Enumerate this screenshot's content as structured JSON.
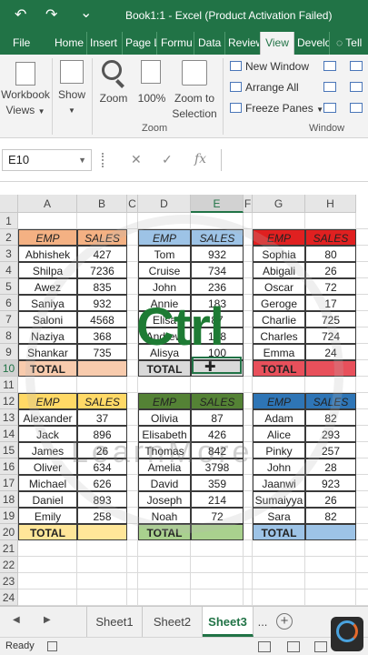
{
  "titlebar": {
    "title": "Book1:1 - Excel (Product Activation Failed)",
    "undo_glyph": "↶",
    "redo_glyph": "↷",
    "customize_glyph": "⌄"
  },
  "ribbon_tabs": [
    {
      "label": "File"
    },
    {
      "label": "Home"
    },
    {
      "label": "Insert"
    },
    {
      "label": "Page L"
    },
    {
      "label": "Formu"
    },
    {
      "label": "Data"
    },
    {
      "label": "Review"
    },
    {
      "label": "View"
    },
    {
      "label": "Develo"
    },
    {
      "label": "Tell"
    }
  ],
  "ribbon": {
    "workbook_views": "Workbook",
    "workbook_views_2": "Views",
    "show": "Show",
    "zoom": "Zoom",
    "zoom_100": "100%",
    "zoom_to": "Zoom to",
    "selection": "Selection",
    "group_zoom": "Zoom",
    "new_window": "New Window",
    "arrange_all": "Arrange All",
    "freeze_panes": "Freeze Panes",
    "group_window": "Window"
  },
  "formula_bar": {
    "name_box": "E10",
    "cancel_glyph": "✕",
    "enter_glyph": "✓",
    "fx_glyph": "fx"
  },
  "columns": [
    "A",
    "B",
    "C",
    "D",
    "E",
    "F",
    "G",
    "H"
  ],
  "rows": [
    "1",
    "2",
    "3",
    "4",
    "5",
    "6",
    "7",
    "8",
    "9",
    "10",
    "11",
    "12",
    "13",
    "14",
    "15",
    "16",
    "17",
    "18",
    "19",
    "20",
    "21",
    "22",
    "23",
    "24"
  ],
  "tables": [
    {
      "hdr": [
        "EMP",
        "SALES"
      ],
      "hdr_color": "#f4b183",
      "rows": [
        [
          "Abhishek",
          "427"
        ],
        [
          "Shilpa",
          "7236"
        ],
        [
          "Awez",
          "835"
        ],
        [
          "Saniya",
          "932"
        ],
        [
          "Saloni",
          "4568"
        ],
        [
          "Naziya",
          "368"
        ],
        [
          "Shankar",
          "735"
        ]
      ],
      "total": "TOTAL",
      "total_color": "#f8cbad"
    },
    {
      "hdr": [
        "EMP",
        "SALES"
      ],
      "hdr_color": "#9dc3e6",
      "rows": [
        [
          "Tom",
          "932"
        ],
        [
          "Cruise",
          "734"
        ],
        [
          "John",
          "236"
        ],
        [
          "Annie",
          "183"
        ],
        [
          "Elisa",
          "87"
        ],
        [
          "Andrew",
          "158"
        ],
        [
          "Alisya",
          "100"
        ]
      ],
      "total": "TOTAL",
      "total_color": "#d9d9d9"
    },
    {
      "hdr": [
        "EMP",
        "SALES"
      ],
      "hdr_color": "#e02020",
      "rows": [
        [
          "Sophia",
          "80"
        ],
        [
          "Abigali",
          "26"
        ],
        [
          "Oscar",
          "72"
        ],
        [
          "Geroge",
          "17"
        ],
        [
          "Charlie",
          "725"
        ],
        [
          "Charles",
          "724"
        ],
        [
          "Emma",
          "24"
        ]
      ],
      "total": "TOTAL",
      "total_color": "#e8505b"
    },
    {
      "hdr": [
        "EMP",
        "SALES"
      ],
      "hdr_color": "#ffd966",
      "rows": [
        [
          "Alexander",
          "37"
        ],
        [
          "Jack",
          "896"
        ],
        [
          "James",
          "26"
        ],
        [
          "Oliver",
          "634"
        ],
        [
          "Michael",
          "626"
        ],
        [
          "Daniel",
          "893"
        ],
        [
          "Emily",
          "258"
        ]
      ],
      "total": "TOTAL",
      "total_color": "#ffe699"
    },
    {
      "hdr": [
        "EMP",
        "SALES"
      ],
      "hdr_color": "#548235",
      "rows": [
        [
          "Olivia",
          "87"
        ],
        [
          "Elisabeth",
          "426"
        ],
        [
          "Thomas",
          "842"
        ],
        [
          "Amelia",
          "3798"
        ],
        [
          "David",
          "359"
        ],
        [
          "Joseph",
          "214"
        ],
        [
          "Noah",
          "72"
        ]
      ],
      "total": "TOTAL",
      "total_color": "#a9d18e"
    },
    {
      "hdr": [
        "EMP",
        "SALES"
      ],
      "hdr_color": "#2e75b6",
      "rows": [
        [
          "Adam",
          "82"
        ],
        [
          "Alice",
          "293"
        ],
        [
          "Pinky",
          "257"
        ],
        [
          "John",
          "28"
        ],
        [
          "Jaanwi",
          "923"
        ],
        [
          "Sumaiyya",
          "26"
        ],
        [
          "Sara",
          "82"
        ]
      ],
      "total": "TOTAL",
      "total_color": "#9dc3e6"
    }
  ],
  "overlay": {
    "ctrl": "Ctrl",
    "watermark": "LearnMore"
  },
  "sheets": [
    "Sheet1",
    "Sheet2",
    "Sheet3",
    "..."
  ],
  "add_sheet_glyph": "+",
  "status": {
    "ready": "Ready"
  }
}
